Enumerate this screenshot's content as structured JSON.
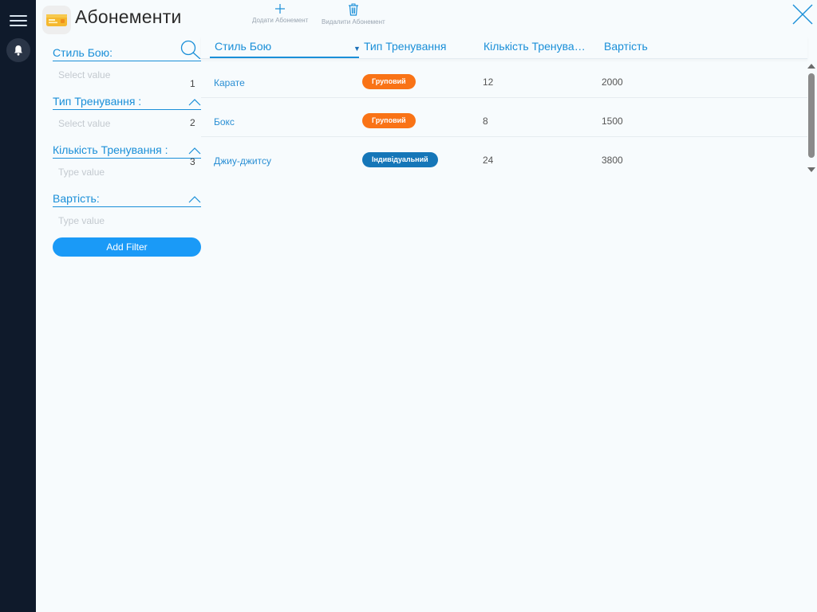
{
  "header": {
    "title": "Абонементи",
    "add_label": "Додати Абонемент",
    "delete_label": "Видалити Абонемент"
  },
  "filters": [
    {
      "label": "Стиль Бою:",
      "placeholder": "Select value"
    },
    {
      "label": "Тип Тренування :",
      "placeholder": "Select value"
    },
    {
      "label": "Кількість Тренування :",
      "placeholder": "Type value"
    },
    {
      "label": "Вартість:",
      "placeholder": "Type value"
    }
  ],
  "add_filter_label": "Add Filter",
  "table": {
    "columns": [
      "Стиль Бою",
      "Тип Тренування",
      "Кількість Тренува…",
      "Вартість"
    ],
    "rows": [
      {
        "num": "1",
        "style": "Карате",
        "type": "Груповий",
        "type_kind": "group",
        "count": "12",
        "price": "2000"
      },
      {
        "num": "2",
        "style": "Бокс",
        "type": "Груповий",
        "type_kind": "group",
        "count": "8",
        "price": "1500"
      },
      {
        "num": "3",
        "style": "Джиу-джитсу",
        "type": "Індивідуальний",
        "type_kind": "individual",
        "count": "24",
        "price": "3800"
      }
    ]
  },
  "colors": {
    "accent": "#1a8fd8",
    "sidebar": "#0f1a2b",
    "badge_group": "#f97316",
    "badge_individual": "#1576b8",
    "add_filter": "#1a9af7"
  },
  "icons": {
    "menu": "hamburger-icon",
    "notifications": "bell-icon",
    "app": "ticket-icon",
    "add": "plus-icon",
    "delete": "trash-icon",
    "close": "close-icon",
    "search": "search-icon",
    "collapse": "chevron-up-icon",
    "sort": "caret-down-icon"
  }
}
